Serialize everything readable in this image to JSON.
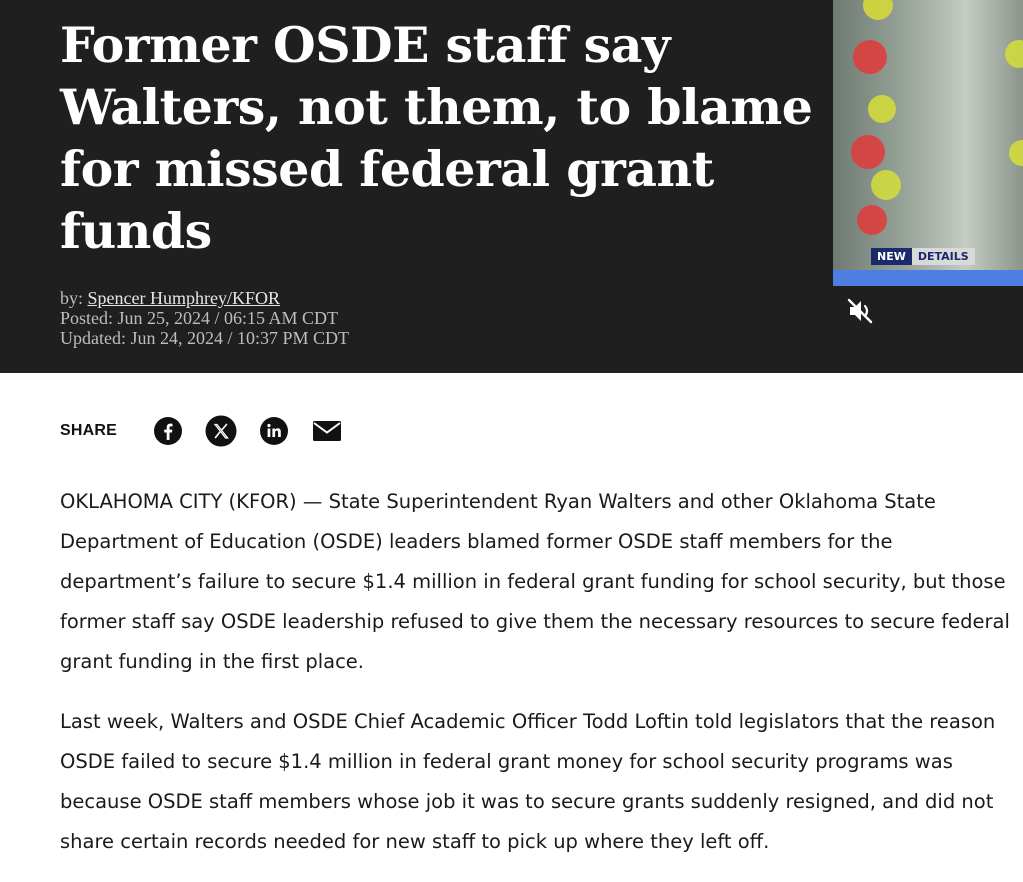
{
  "article": {
    "headline": "Former OSDE staff say Walters, not them, to blame for missed federal grant funds",
    "byline_prefix": "by: ",
    "author": "Spencer Humphrey/KFOR",
    "posted": "Posted: Jun 25, 2024 / 06:15 AM CDT",
    "updated": "Updated: Jun 24, 2024 / 10:37 PM CDT",
    "paragraphs": [
      "OKLAHOMA CITY (KFOR) — State Superintendent Ryan Walters and other Oklahoma State Department of Education (OSDE) leaders blamed former OSDE staff members for the department’s failure to secure $1.4 million in federal grant funding for school security, but those former staff say OSDE leadership refused to give them the necessary resources to secure federal grant funding in the first place.",
      "Last week, Walters and OSDE Chief Academic Officer Todd Loftin told legislators that the reason OSDE failed to secure $1.4 million in federal grant money for school security programs was because OSDE staff members whose job it was to secure grants suddenly resigned, and did not share certain records needed for new staff to pick up where they left off."
    ]
  },
  "video": {
    "tag_new": "NEW",
    "tag_details": "DETAILS",
    "mute_icon": "muted-speaker-icon"
  },
  "share": {
    "label": "SHARE",
    "icons": [
      "facebook-icon",
      "x-icon",
      "linkedin-icon",
      "email-icon"
    ]
  },
  "colors": {
    "hero_background": "#1f1f1f",
    "headline_text": "#ffffff",
    "meta_text": "#bdbdbd",
    "video_tag_blue": "#1b2a6b",
    "video_bar_blue": "#4d7ee0"
  }
}
